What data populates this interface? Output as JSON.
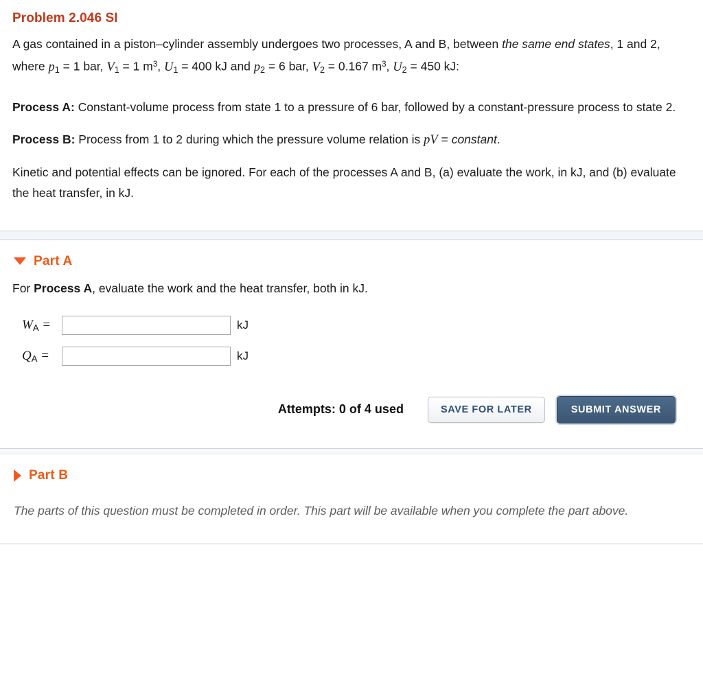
{
  "problem": {
    "title": "Problem 2.046 SI",
    "statement_parts": {
      "s1": "A gas contained in a piston–cylinder assembly undergoes two processes, A and B, between ",
      "s2_italic": "the same end states",
      "s3": ", 1 and 2, where ",
      "p1_var": "p",
      "p1_sub": "1",
      "p1_val": " = 1 bar, ",
      "V1_var": "V",
      "V1_sub": "1",
      "V1_val": " = 1 m",
      "V1_sup": "3",
      "comma1": ", ",
      "U1_var": "U",
      "U1_sub": "1",
      "U1_val": " = 400 kJ and ",
      "p2_var": "p",
      "p2_sub": "2",
      "p2_val": " = 6 bar, ",
      "V2_var": "V",
      "V2_sub": "2",
      "V2_val": " = 0.167 m",
      "V2_sup": "3",
      "comma2": ", ",
      "U2_var": "U",
      "U2_sub": "2",
      "U2_val": " = 450 kJ:"
    },
    "process_a_label": "Process A:",
    "process_a_text": " Constant-volume process from state 1 to a pressure of 6 bar, followed by a constant-pressure process to state 2.",
    "process_b_label": "Process B:",
    "process_b_text": " Process from 1 to 2 during which the pressure volume relation is ",
    "process_b_relation_p": "pV",
    "process_b_relation_eq": " = ",
    "process_b_relation_const": "constant",
    "process_b_period": ".",
    "closing_text": "Kinetic and potential effects can be ignored. For each of the processes A and B, (a) evaluate the work, in kJ, and (b) evaluate the heat transfer, in kJ."
  },
  "part_a": {
    "toggle_icon": "triangle-down-icon",
    "title": "Part A",
    "prompt_prefix": "For ",
    "prompt_bold": "Process A",
    "prompt_suffix": ", evaluate the work and the heat transfer, both in kJ.",
    "fields": [
      {
        "symbol": "W",
        "subscript": "A",
        "equals": " =",
        "value": "",
        "placeholder": "",
        "unit": "kJ"
      },
      {
        "symbol": "Q",
        "subscript": "A",
        "equals": " =",
        "value": "",
        "placeholder": "",
        "unit": "kJ"
      }
    ],
    "attempts_text": "Attempts: 0 of 4 used",
    "save_label": "SAVE FOR LATER",
    "submit_label": "SUBMIT ANSWER"
  },
  "part_b": {
    "toggle_icon": "triangle-right-icon",
    "title": "Part B",
    "locked_note": "The parts of this question must be completed in order. This part will be available when you complete the part above."
  },
  "colors": {
    "problem_title": "#c0391b",
    "part_title": "#ec5b18",
    "triangle": "#f15a22",
    "submit_bg": "#3c5673",
    "save_text": "#2e4d76",
    "separator_bg": "#f2f6f9"
  }
}
